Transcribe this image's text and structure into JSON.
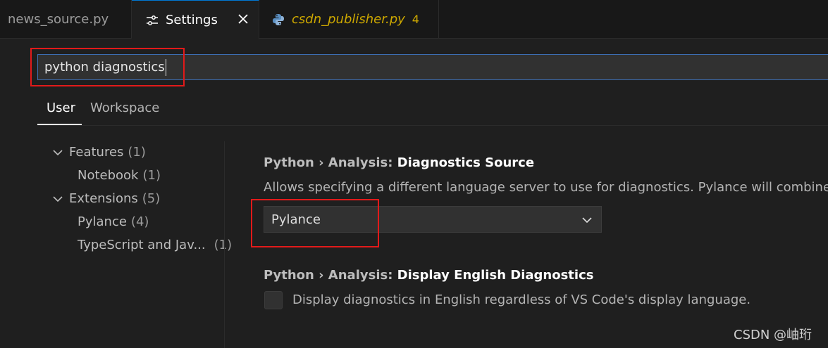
{
  "tabs": [
    {
      "label": "news_source.py"
    },
    {
      "label": "Settings"
    },
    {
      "label": "csdn_publisher.py",
      "badge": "4"
    }
  ],
  "search": {
    "value": "python diagnostics"
  },
  "scopes": [
    {
      "label": "User"
    },
    {
      "label": "Workspace"
    }
  ],
  "toc": [
    {
      "label": "Features",
      "count": "(1)"
    },
    {
      "label": "Notebook",
      "count": "(1)"
    },
    {
      "label": "Extensions",
      "count": "(5)"
    },
    {
      "label": "Pylance",
      "count": "(4)"
    },
    {
      "label": "TypeScript and Jav...",
      "count": "(1)"
    }
  ],
  "settings": [
    {
      "prefix": "Python › Analysis: ",
      "name": "Diagnostics Source",
      "description": "Allows specifying a different language server to use for diagnostics. Pylance will combine its r",
      "value": "Pylance"
    },
    {
      "prefix": "Python › Analysis: ",
      "name": "Display English Diagnostics",
      "description": "Display diagnostics in English regardless of VS Code's display language.",
      "checked": false
    }
  ],
  "watermark": "CSDN @岫珩",
  "icons": {
    "settings_tab": "settings-sliders-icon",
    "close": "close-icon",
    "python_file": "python-file-icon",
    "expand": "chevron-down-icon",
    "dropdown": "chevron-down-icon"
  },
  "colors": {
    "accent": "#0078d4",
    "highlight": "#e21a1a",
    "warning": "#cca700"
  }
}
